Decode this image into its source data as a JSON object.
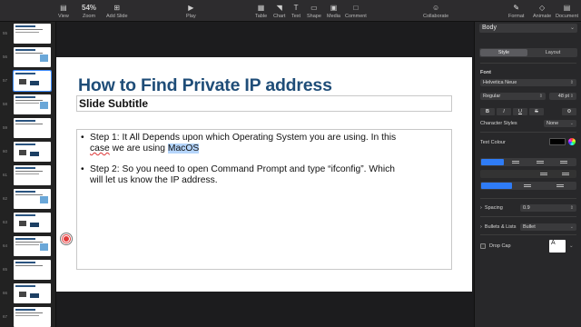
{
  "toolbar": {
    "view_label": "View",
    "zoom_value": "54%",
    "zoom_label": "Zoom",
    "add_slide_label": "Add Slide",
    "play_label": "Play",
    "table_label": "Table",
    "chart_label": "Chart",
    "text_label": "Text",
    "shape_label": "Shape",
    "media_label": "Media",
    "comment_label": "Comment",
    "collaborate_label": "Collaborate",
    "format_label": "Format",
    "animate_label": "Animate",
    "document_label": "Document"
  },
  "navigator": {
    "slides": [
      {
        "num": "55"
      },
      {
        "num": "56"
      },
      {
        "num": "57"
      },
      {
        "num": "58"
      },
      {
        "num": "59"
      },
      {
        "num": "60"
      },
      {
        "num": "61"
      },
      {
        "num": "62"
      },
      {
        "num": "63"
      },
      {
        "num": "64"
      },
      {
        "num": "65"
      },
      {
        "num": "66"
      },
      {
        "num": "67"
      }
    ],
    "selected": "57"
  },
  "slide": {
    "title": "How to Find Private IP address",
    "subtitle": "Slide Subtitle",
    "bullet1_a": "Step 1: It All Depends upon which Operating System you are using. In this",
    "bullet1_b_pre": "case",
    "bullet1_b_mid": " we are using ",
    "bullet1_b_hl": "MacOS",
    "bullet2_a": "Step 2: So you need to open Command Prompt and type “ifconfig”. Which",
    "bullet2_b": "will let us know the IP address.",
    "bullet_char": "•"
  },
  "inspector": {
    "style_value": "Body",
    "tab_style": "Style",
    "tab_layout": "Layout",
    "font_label": "Font",
    "font_name": "Helvetica Neue",
    "font_weight": "Regular",
    "font_size": "48 pt",
    "bold": "B",
    "italic": "I",
    "underline": "U",
    "strike": "S",
    "char_styles_label": "Character Styles",
    "char_styles_value": "None",
    "text_colour_label": "Text Colour",
    "spacing_label": "Spacing",
    "spacing_value": "0.9",
    "bullets_label": "Bullets & Lists",
    "bullets_value": "Bullet",
    "drop_cap_label": "Drop Cap",
    "drop_cap_sample": "A"
  },
  "colors": {
    "title": "#1f4d78",
    "accent": "#2f7cf6",
    "selection": "#b5d5fb"
  }
}
